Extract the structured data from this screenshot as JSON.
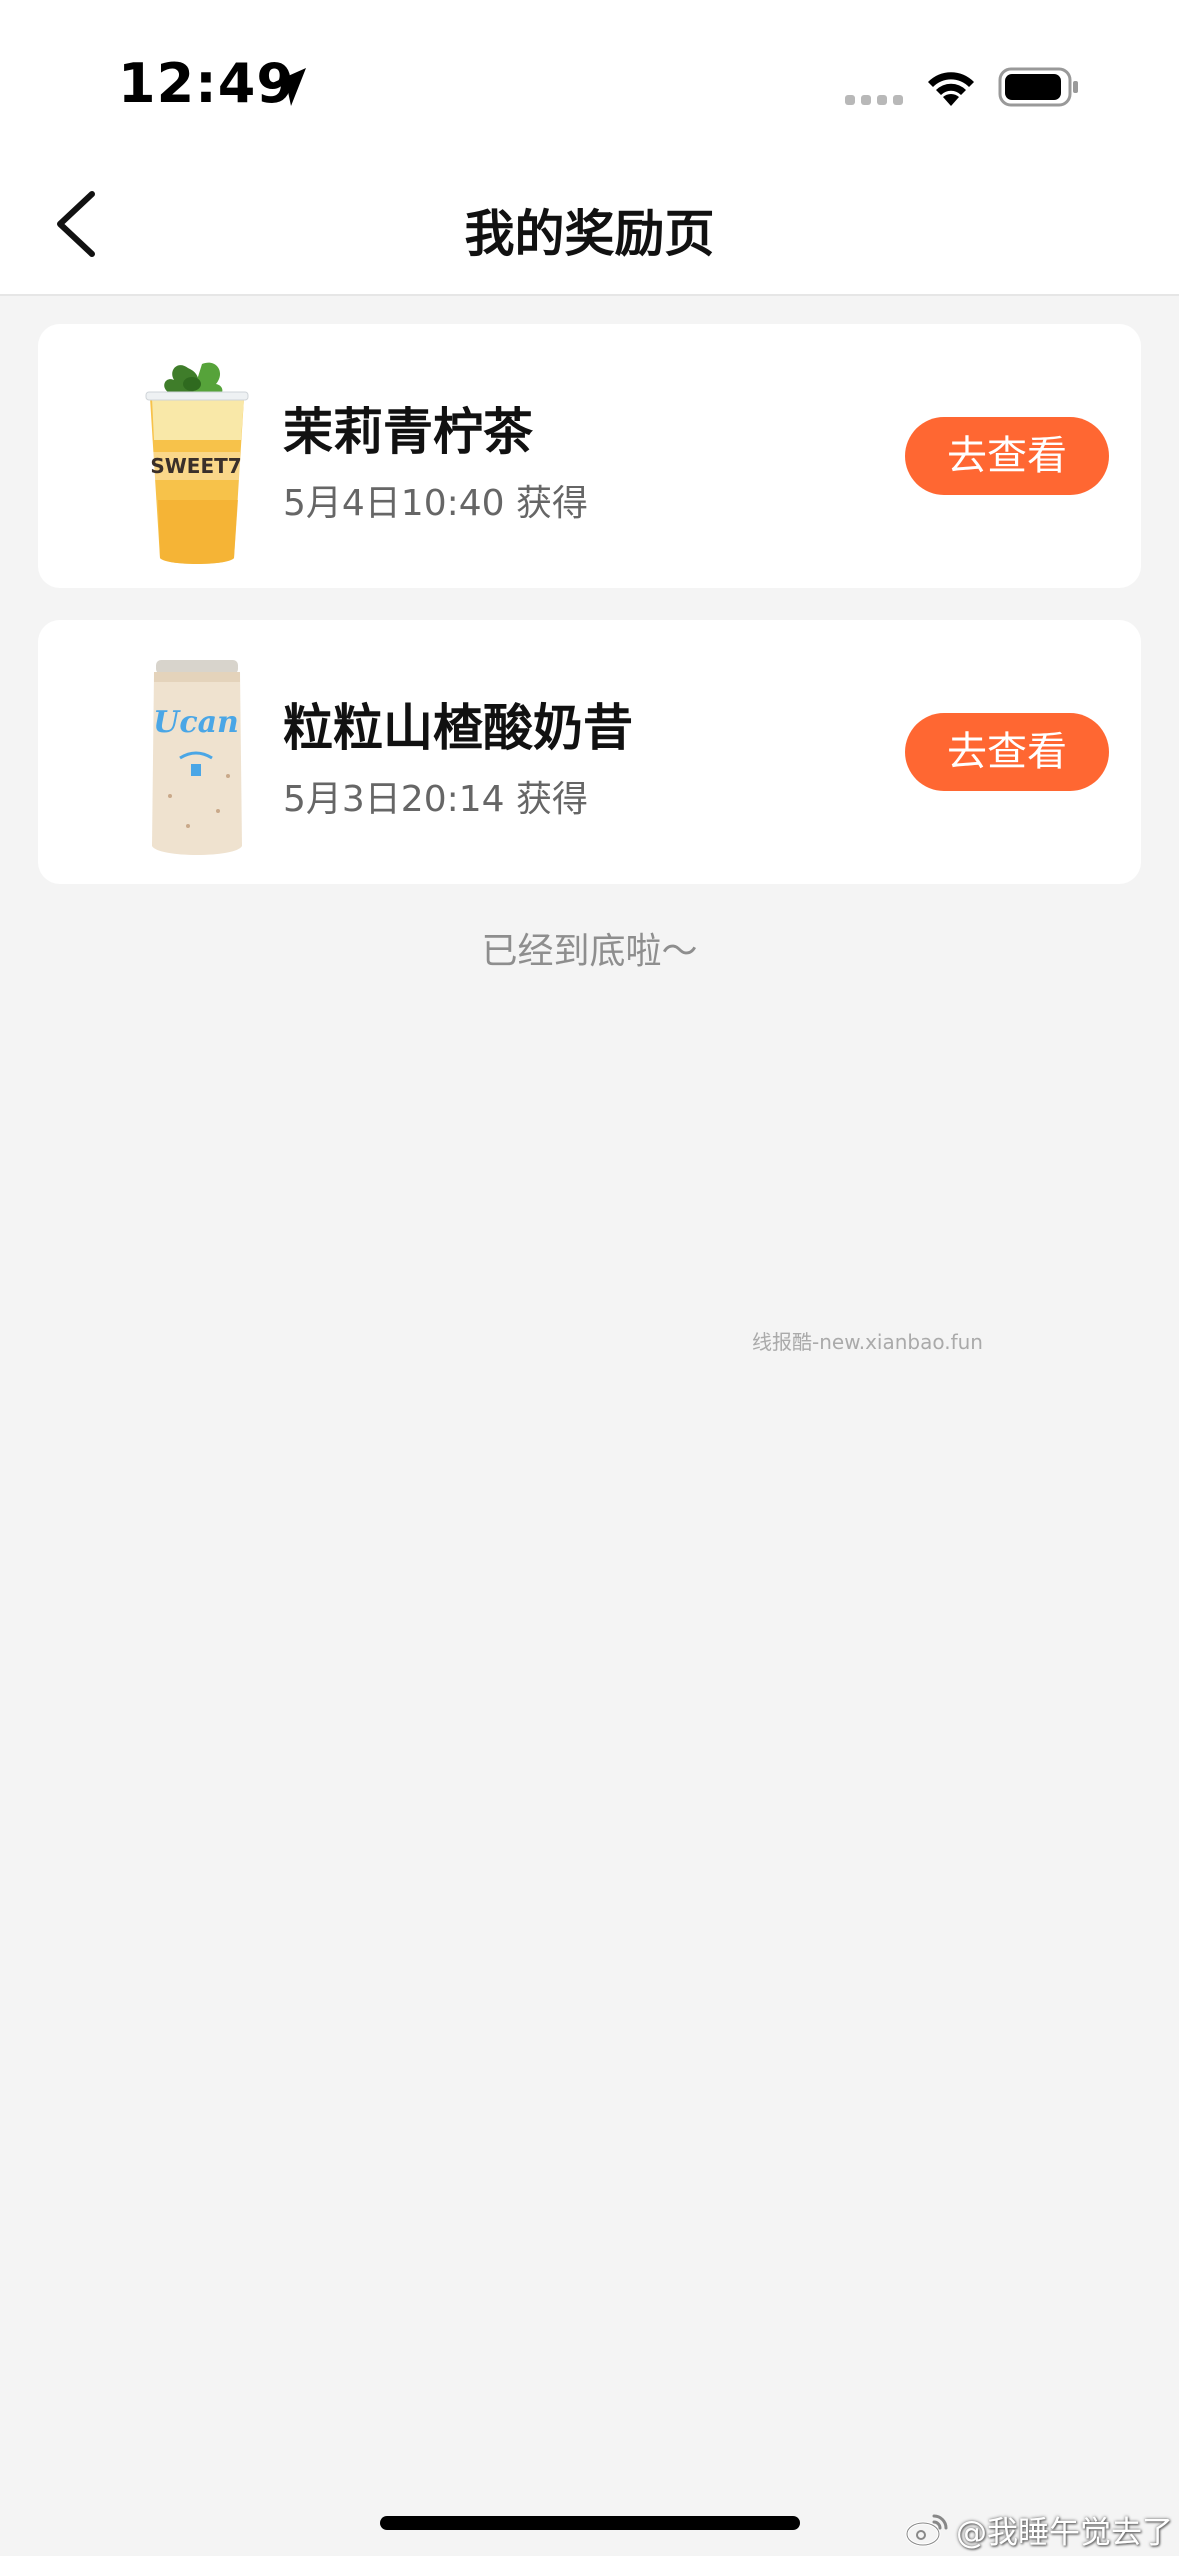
{
  "status_bar": {
    "time": "12:49",
    "icons": [
      "location-arrow-icon",
      "signal-dots-icon",
      "wifi-icon",
      "battery-icon"
    ]
  },
  "nav": {
    "title": "我的奖励页",
    "back_icon": "chevron-left-icon"
  },
  "rewards": [
    {
      "name": "茉莉青柠茶",
      "time": "5月4日10:40 获得",
      "button": "去查看",
      "image_text": "SWEET7"
    },
    {
      "name": "粒粒山楂酸奶昔",
      "time": "5月3日20:14 获得",
      "button": "去查看",
      "image_text": "Ucan"
    }
  ],
  "end_text": "已经到底啦～",
  "watermark": "线报酷-new.xianbao.fun",
  "weibo_credit": "@我睡午觉去了",
  "colors": {
    "accent": "#ff6732",
    "background": "#f4f4f4",
    "card": "#ffffff"
  }
}
